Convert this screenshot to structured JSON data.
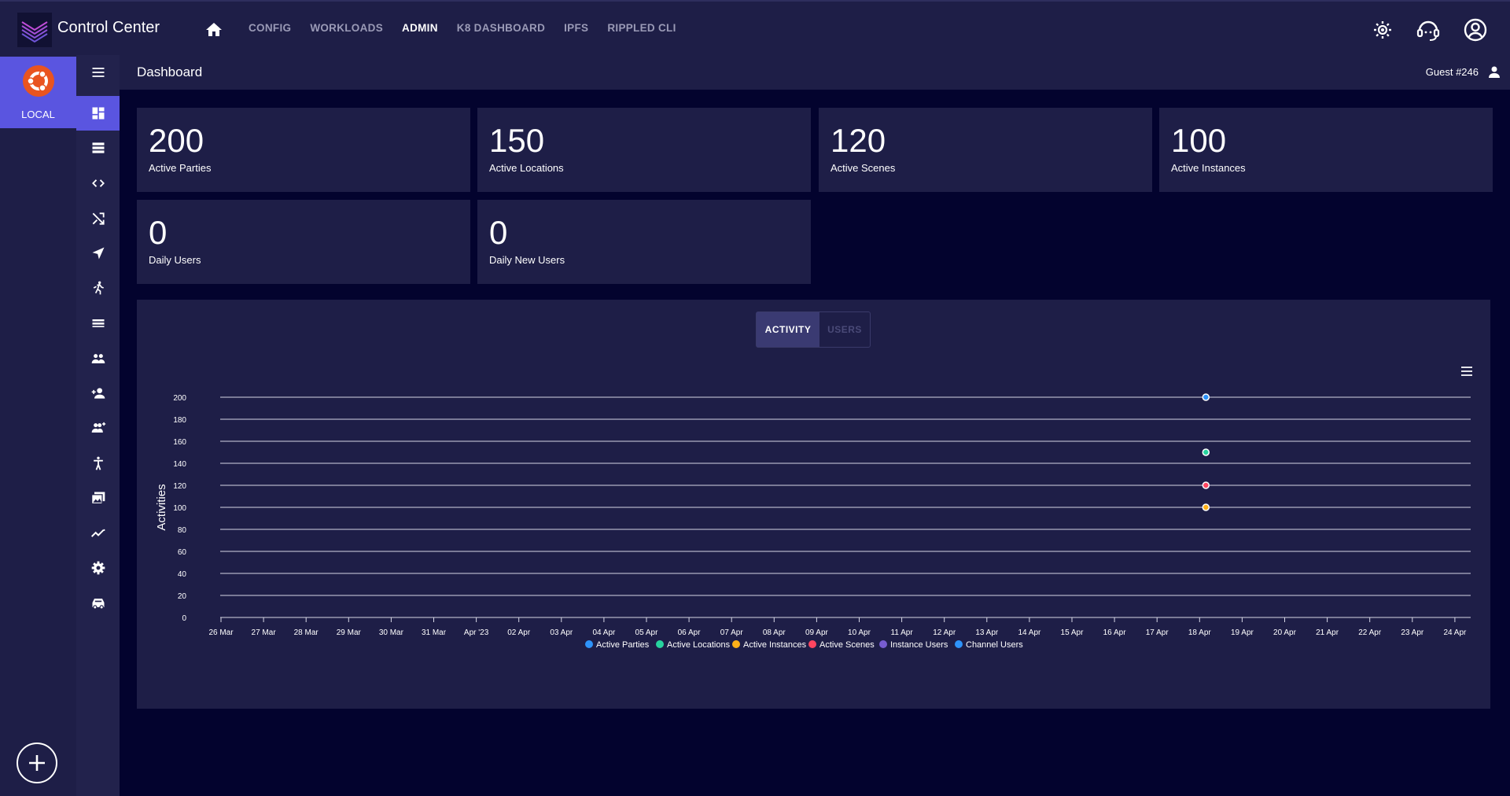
{
  "app": {
    "title": "Control Center"
  },
  "nav": {
    "items": [
      {
        "label": "CONFIG",
        "active": false
      },
      {
        "label": "WORKLOADS",
        "active": false
      },
      {
        "label": "ADMIN",
        "active": true
      },
      {
        "label": "K8 DASHBOARD",
        "active": false
      },
      {
        "label": "IPFS",
        "active": false
      },
      {
        "label": "RIPPLED CLI",
        "active": false
      }
    ]
  },
  "rail": {
    "local_label": "LOCAL"
  },
  "header": {
    "title": "Dashboard",
    "user": "Guest #246"
  },
  "cards": [
    {
      "value": "200",
      "label": "Active Parties"
    },
    {
      "value": "150",
      "label": "Active Locations"
    },
    {
      "value": "120",
      "label": "Active Scenes"
    },
    {
      "value": "100",
      "label": "Active Instances"
    },
    {
      "value": "0",
      "label": "Daily Users"
    },
    {
      "value": "0",
      "label": "Daily New Users"
    }
  ],
  "chart_tabs": {
    "activity": "ACTIVITY",
    "users": "USERS"
  },
  "colors": {
    "accent": "#5a55e0",
    "bg": "#03032e",
    "panel": "#1e1e47"
  },
  "chart_data": {
    "type": "line",
    "ylabel": "Activities",
    "ylim": [
      0,
      200
    ],
    "yticks": [
      0,
      20,
      40,
      60,
      80,
      100,
      120,
      140,
      160,
      180,
      200
    ],
    "grid": true,
    "legend_position": "bottom",
    "x": [
      "26 Mar",
      "27 Mar",
      "28 Mar",
      "29 Mar",
      "30 Mar",
      "31 Mar",
      "Apr '23",
      "02 Apr",
      "03 Apr",
      "04 Apr",
      "05 Apr",
      "06 Apr",
      "07 Apr",
      "08 Apr",
      "09 Apr",
      "10 Apr",
      "11 Apr",
      "12 Apr",
      "13 Apr",
      "14 Apr",
      "15 Apr",
      "16 Apr",
      "17 Apr",
      "18 Apr",
      "19 Apr",
      "20 Apr",
      "21 Apr",
      "22 Apr",
      "23 Apr",
      "24 Apr"
    ],
    "series": [
      {
        "name": "Active Parties",
        "color": "#2e93fa",
        "points": [
          {
            "x": "18 Apr",
            "y": 200
          }
        ]
      },
      {
        "name": "Active Locations",
        "color": "#27d39e",
        "points": [
          {
            "x": "18 Apr",
            "y": 150
          }
        ]
      },
      {
        "name": "Active Instances",
        "color": "#feb019",
        "points": [
          {
            "x": "18 Apr",
            "y": 100
          }
        ]
      },
      {
        "name": "Active Scenes",
        "color": "#ff4560",
        "points": [
          {
            "x": "18 Apr",
            "y": 120
          }
        ]
      },
      {
        "name": "Instance Users",
        "color": "#775dd0",
        "points": []
      },
      {
        "name": "Channel Users",
        "color": "#2e93fa",
        "points": []
      }
    ]
  }
}
